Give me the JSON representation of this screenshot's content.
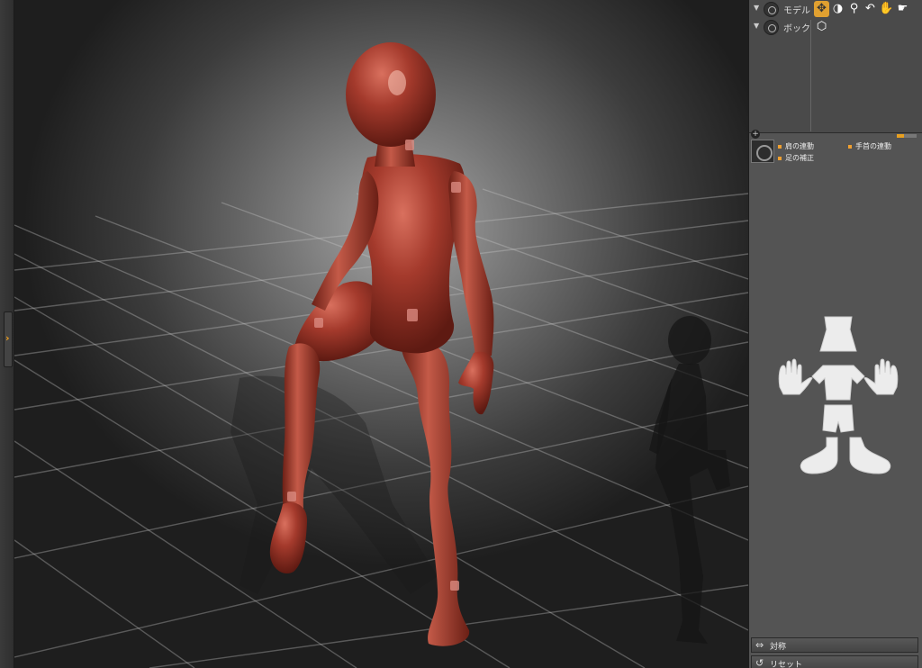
{
  "layers": [
    {
      "label": "モデル",
      "expanded": true
    },
    {
      "label": "ボック",
      "expanded": true
    }
  ],
  "tool_icons": [
    "move-gizmo-icon",
    "rotate-icon",
    "zoom-icon",
    "undo-rotate-icon",
    "hand-pose-icon",
    "hand-pose-alt-icon"
  ],
  "layer_meter": 0.35,
  "link_options": {
    "shoulder": "肩の連動",
    "wrist": "手首の連動",
    "foot": "足の補正"
  },
  "buttons": {
    "symmetry": "対称",
    "reset": "リセット"
  },
  "colors": {
    "accent": "#e8a020",
    "figure": "#a83a2c",
    "panel": "#545454"
  }
}
